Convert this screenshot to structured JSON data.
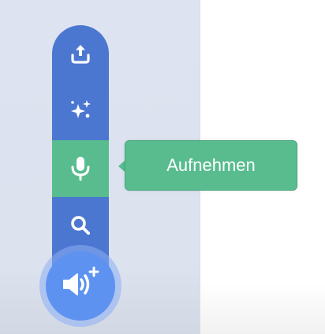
{
  "sound_menu": {
    "items": [
      {
        "icon": "upload-icon"
      },
      {
        "icon": "surprise-sparkle-icon"
      },
      {
        "icon": "microphone-icon",
        "active": true
      },
      {
        "icon": "search-icon"
      }
    ],
    "main_button_icon": "speaker-plus-icon"
  },
  "tooltip": {
    "label": "Aufnehmen"
  },
  "colors": {
    "menu_blue": "#4c77d0",
    "active_green": "#58bc8f",
    "main_button_blue": "#5d92f0",
    "left_pane_bg": "#dde3f0"
  }
}
